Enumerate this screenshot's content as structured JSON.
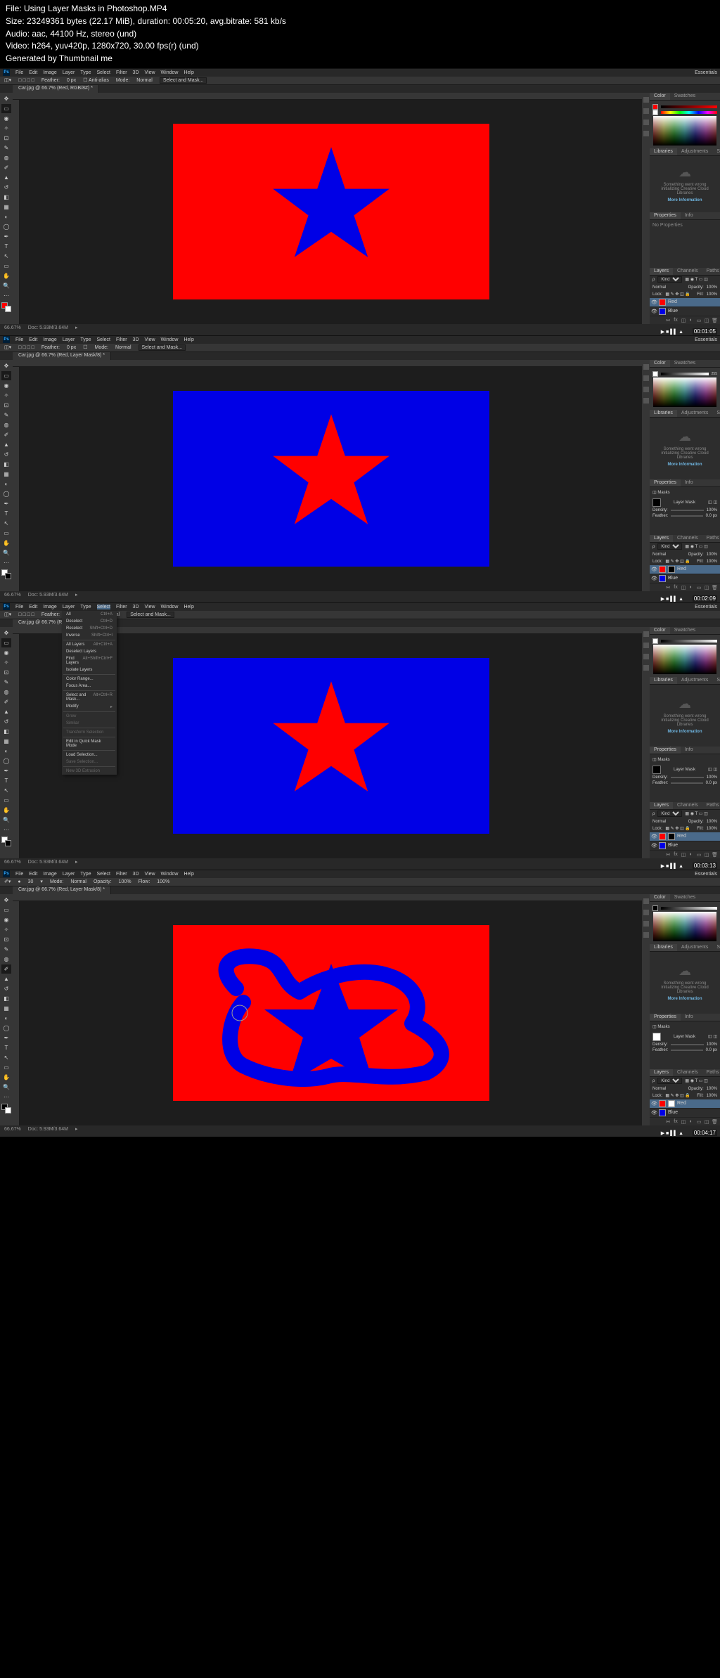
{
  "header": {
    "file": "File: Using Layer Masks in Photoshop.MP4",
    "size": "Size: 23249361 bytes (22.17 MiB), duration: 00:05:20, avg.bitrate: 581 kb/s",
    "audio": "Audio: aac, 44100 Hz, stereo (und)",
    "video": "Video: h264, yuv420p, 1280x720, 30.00 fps(r) (und)",
    "gen": "Generated by Thumbnail me"
  },
  "menu": [
    "File",
    "Edit",
    "Image",
    "Layer",
    "Type",
    "Select",
    "Filter",
    "3D",
    "View",
    "Window",
    "Help"
  ],
  "workspace_label": "Essentials",
  "options": {
    "mode_label": "Mode:",
    "mode_val": "Normal",
    "opacity_label": "Opacity:",
    "opacity_val": "100%",
    "feather_label": "Feather:",
    "feather_val": "0 px",
    "btn_select_mask": "Select and Mask..."
  },
  "tabs": {
    "s1": "Car.jpg @ 66.7% (Red, RGB/8#) *",
    "s2": "Car.jpg @ 66.7% (Red, Layer Mask/8) *",
    "s3": "Car.jpg @ 66.7% (Red, Layer Mask/8) *",
    "s4": "Car.jpg @ 66.7% (Red, Layer Mask/8) *"
  },
  "zoom": "66.67%",
  "docinfo": "Doc: 5.93M/3.64M",
  "panel_labels": {
    "color": "Color",
    "swatches": "Swatches",
    "libraries": "Libraries",
    "adjustments": "Adjustments",
    "styles": "Styles",
    "properties": "Properties",
    "info": "Info",
    "layers": "Layers",
    "channels": "Channels",
    "paths": "Paths",
    "no_props": "No Properties",
    "lib_err": "Something went wrong initializing Creative Cloud Libraries",
    "lib_more": "More Information",
    "kind": "Kind",
    "masks": "Masks",
    "layer_mask": "Layer Mask",
    "density": "Density:",
    "density_val": "100%",
    "feather": "Feather:",
    "feather_val": "0.0 px"
  },
  "layers": {
    "opt_normal": "Normal",
    "opt_opacity": "Opacity:",
    "opt_fill": "Fill:",
    "opt_lock": "Lock:",
    "val100": "100%",
    "name_red": "Red",
    "name_blue": "Blue"
  },
  "colors": {
    "red": "#ff0000",
    "blue": "#0000e6",
    "white": "#ffffff",
    "black": "#000000"
  },
  "select_menu": [
    {
      "label": "All",
      "sc": "Ctrl+A"
    },
    {
      "label": "Deselect",
      "sc": "Ctrl+D"
    },
    {
      "label": "Reselect",
      "sc": "Shift+Ctrl+D"
    },
    {
      "label": "Inverse",
      "sc": "Shift+Ctrl+I"
    },
    {
      "sep": true
    },
    {
      "label": "All Layers",
      "sc": "Alt+Ctrl+A"
    },
    {
      "label": "Deselect Layers",
      "sc": ""
    },
    {
      "label": "Find Layers",
      "sc": "Alt+Shift+Ctrl+F"
    },
    {
      "label": "Isolate Layers",
      "sc": ""
    },
    {
      "sep": true
    },
    {
      "label": "Color Range...",
      "sc": ""
    },
    {
      "label": "Focus Area...",
      "sc": ""
    },
    {
      "sep": true
    },
    {
      "label": "Select and Mask...",
      "sc": "Alt+Ctrl+R"
    },
    {
      "label": "Modify",
      "sc": "▸"
    },
    {
      "sep": true
    },
    {
      "label": "Grow",
      "sc": "",
      "dis": true
    },
    {
      "label": "Similar",
      "sc": "",
      "dis": true
    },
    {
      "sep": true
    },
    {
      "label": "Transform Selection",
      "sc": "",
      "dis": true
    },
    {
      "sep": true
    },
    {
      "label": "Edit in Quick Mask Mode",
      "sc": ""
    },
    {
      "sep": true
    },
    {
      "label": "Load Selection...",
      "sc": ""
    },
    {
      "label": "Save Selection...",
      "sc": "",
      "dis": true
    },
    {
      "sep": true
    },
    {
      "label": "New 3D Extrusion",
      "sc": "",
      "dis": true
    }
  ],
  "timestamps": {
    "s1": "00:01:05",
    "s2": "00:02:09",
    "s3": "00:03:13",
    "s4": "00:04:17"
  },
  "brush_opts": {
    "size": "30",
    "opacity": "100%",
    "flow": "100%"
  }
}
